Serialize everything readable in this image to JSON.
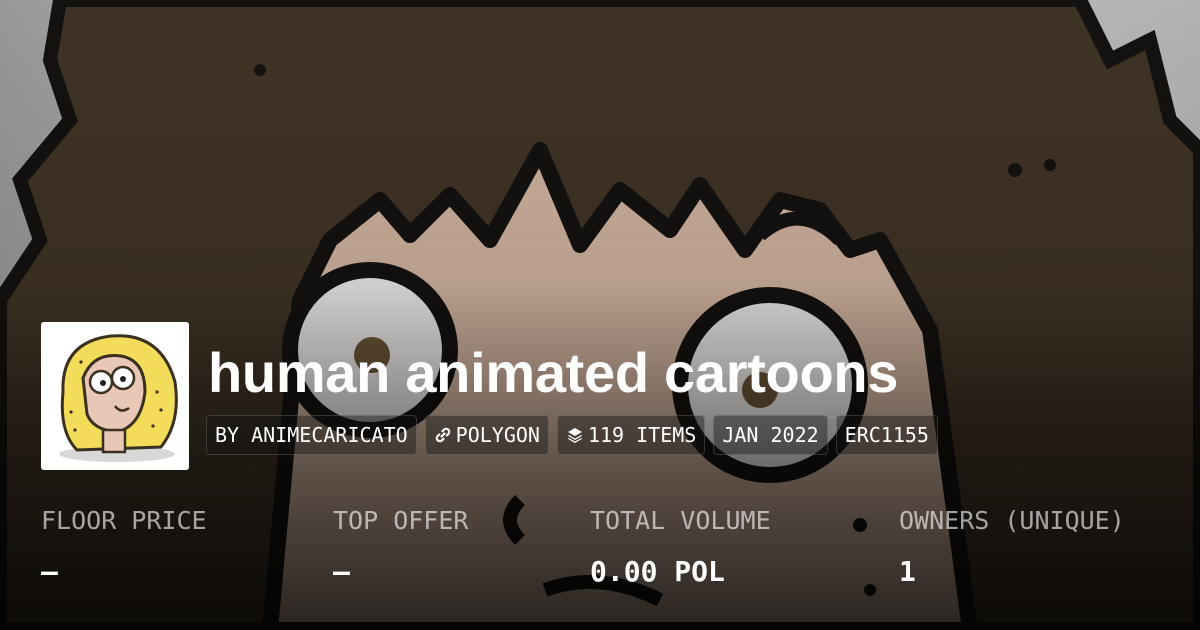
{
  "collection": {
    "name": "human animated cartoons",
    "tags": [
      {
        "label": "BY ANIMECARICATO",
        "icon": ""
      },
      {
        "label": "POLYGON",
        "icon": "link-icon"
      },
      {
        "label": "119 ITEMS",
        "icon": "layers-icon"
      },
      {
        "label": "JAN 2022",
        "icon": ""
      },
      {
        "label": "ERC1155",
        "icon": ""
      }
    ]
  },
  "stats": [
    {
      "label": "FLOOR PRICE",
      "value": "–"
    },
    {
      "label": "TOP OFFER",
      "value": "–"
    },
    {
      "label": "TOTAL VOLUME",
      "value": "0.00 POL"
    },
    {
      "label": "OWNERS (UNIQUE)",
      "value": "1"
    }
  ],
  "colors": {
    "hair": "#3f3325",
    "skin": "#cdb09c",
    "outline": "#141210",
    "text": "#ffffff",
    "muted_text": "#a9a6a3"
  }
}
